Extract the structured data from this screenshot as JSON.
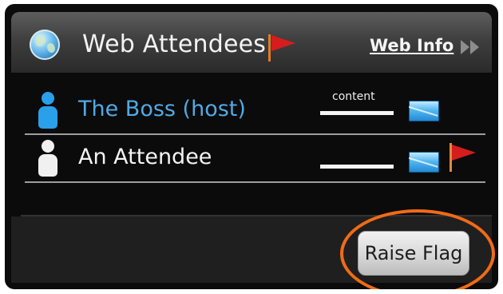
{
  "header": {
    "title": "Web Attendees",
    "web_info_link": "Web Info"
  },
  "attendees": [
    {
      "name": "The Boss (host)",
      "role": "host",
      "content_label": "content",
      "name_color": "#52a9e4",
      "has_flag": false
    },
    {
      "name": "An Attendee",
      "role": "attendee",
      "content_label": "",
      "name_color": "#f4f4f4",
      "has_flag": true
    }
  ],
  "footer": {
    "raise_flag_label": "Raise Flag"
  },
  "colors": {
    "panel_bg": "#0b0b0b",
    "flag_red": "#d51d1d",
    "highlight_orange": "#f06b17",
    "host_blue": "#52a9e4"
  }
}
